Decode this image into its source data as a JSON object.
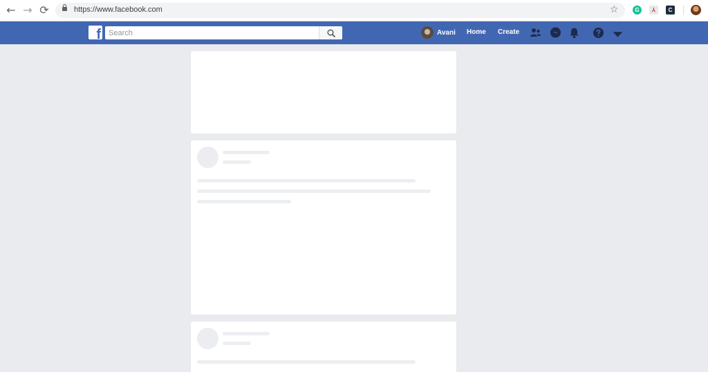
{
  "browser": {
    "back_icon": "arrow-left-icon",
    "forward_icon": "arrow-right-icon",
    "reload_icon": "reload-icon",
    "url": "https://www.facebook.com",
    "extensions": [
      "grammarly-icon",
      "pdf-icon",
      "c-extension-icon"
    ],
    "ext_g": "G",
    "ext_pdf": "⅄",
    "ext_c": "C"
  },
  "topbar": {
    "brand_color": "#4267b2",
    "logo": "f",
    "search_placeholder": "Search",
    "user_name": "Avani",
    "home_label": "Home",
    "create_label": "Create"
  },
  "feed": {
    "background": "#e9ebee",
    "state": "loading-placeholders"
  }
}
